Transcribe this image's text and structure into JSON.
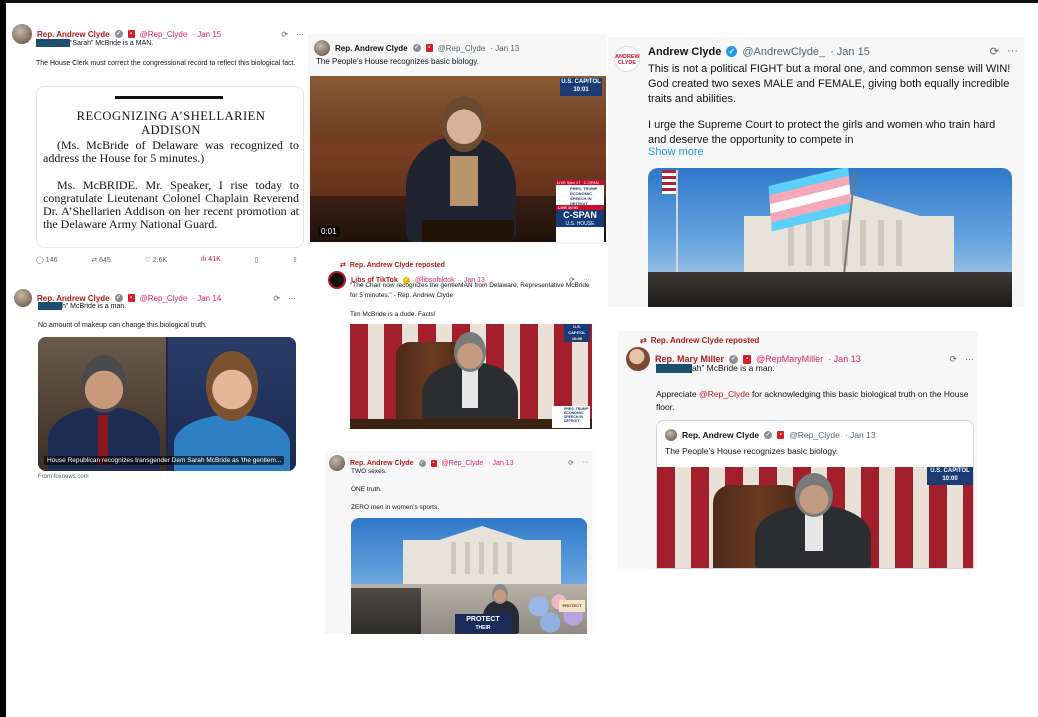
{
  "colors": {
    "accent_red": "#b01c1c",
    "verified_blue": "#1d9bf0",
    "link_blue": "#1d9bf0",
    "cspan_blue": "#163a7a"
  },
  "post1": {
    "name": "Rep. Andrew Clyde",
    "handle": "@Rep_Clyde",
    "date": "· Jan 15",
    "line1": "“Sarah” McBride is a MAN.",
    "line2": "The House Clerk must correct the congressional record to reflect this biological fact.",
    "doc_title": "RECOGNIZING A’SHELLARIEN ADDISON",
    "doc_para1": "(Ms. McBride of Delaware was recognized to address the House for 5 minutes.)",
    "doc_para2": "Ms. McBRIDE. Mr. Speaker, I rise today to congratulate Lieutenant Colonel Chaplain Reverend Dr. A’Shellarien Addison on her recent promotion at the Delaware Army National Guard.",
    "stats": {
      "replies": "146",
      "reposts": "645",
      "likes": "2.6K",
      "views": "41K"
    }
  },
  "post2": {
    "name": "Rep. Andrew Clyde",
    "handle": "@Rep_Clyde",
    "date": "· Jan 13",
    "text": "The People’s House recognizes basic biology.",
    "bug_top": "U.S. CAPITOL",
    "bug_time": "10:01",
    "duration": "0:01",
    "lower_live": "LIVE Sjan 17 · C-SPAN",
    "lower_pres": "PRES. TRUMP ECONOMIC SPEECH IN DETROIT",
    "live_label": "LIVE",
    "live_time": "10:01",
    "cspan_brand": "C-SPAN",
    "cspan_sub": "U.S. HOUSE"
  },
  "post3": {
    "name": "Andrew Clyde",
    "handle": "@AndrewClyde_",
    "date": "· Jan 15",
    "logo_line1": "ANDREW",
    "logo_line2": "CLYDE",
    "para1": "This is not a political FIGHT but a moral one, and common sense will WIN! God created two sexes MALE and FEMALE, giving both equally incredible traits and abilities.",
    "para2": "I urge the Supreme Court to protect the girls and women who train hard and deserve the opportunity to compete in",
    "show_more": "Show more"
  },
  "post4": {
    "name": "Rep. Andrew Clyde",
    "handle": "@Rep_Clyde",
    "date": "· Jan 14",
    "line1": "h” McBride is a man.",
    "line2": "No amount of makeup can change this biological truth.",
    "caption": "House Republican recognizes transgender Dem Sarah McBride as 'the gentlem...",
    "source": "From foxnews.com"
  },
  "post5": {
    "repost_label": "Rep. Andrew Clyde reposted",
    "name": "Libs of TikTok",
    "handle": "@libsoftiktok",
    "date": "· Jan 13",
    "text": "\"The Chair now recognizes the gentleMAN from Delaware, Representative McBride for 5 minutes.\" - Rep. Andrew Clyde",
    "text2": "Tim McBride is a dude. Facts!",
    "bug_top": "U.S. CAPITOL",
    "bug_time": "10:00",
    "lower_pres": "PRES. TRUMP ECONOMIC SPEECH IN DETROIT"
  },
  "post6": {
    "name": "Rep. Andrew Clyde",
    "handle": "@Rep_Clyde",
    "date": "· Jan 13",
    "line1": "TWO sexes.",
    "line2": "ONE truth.",
    "line3": "ZERO men in women’s sports.",
    "sign1": "PROTECT",
    "sign2": "THEIR",
    "sign3": "PROTECT"
  },
  "post7": {
    "repost_label": "Rep. Andrew Clyde reposted",
    "name": "Rep. Mary Miller",
    "handle": "@RepMaryMiller",
    "date": "· Jan 13",
    "line1": "ah” McBride is a man.",
    "appreciate_pre": "Appreciate ",
    "mention": "@Rep_Clyde",
    "appreciate_post": " for acknowledging this basic biological truth on the House floor.",
    "quote_name": "Rep. Andrew Clyde",
    "quote_handle": "@Rep_Clyde",
    "quote_date": "· Jan 13",
    "quote_text": "The People’s House recognizes basic biology.",
    "bug_top": "U.S. CAPITOL",
    "bug_time": "10:00"
  }
}
